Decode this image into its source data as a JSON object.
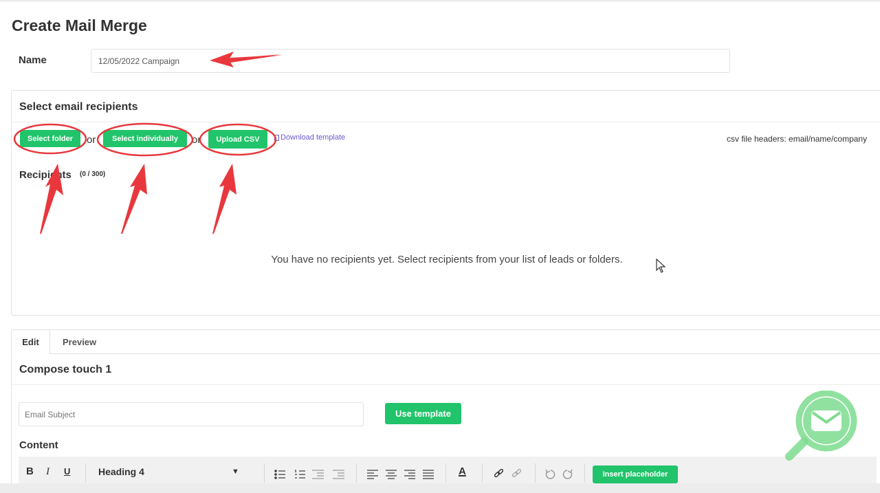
{
  "page": {
    "title": "Create Mail Merge"
  },
  "name_field": {
    "label": "Name",
    "value": "12/05/2022 Campaign"
  },
  "recipients_panel": {
    "title": "Select email recipients",
    "select_folder": "Select folder",
    "or1": "or",
    "select_individually": "Select individually",
    "or2": "or",
    "upload_csv": "Upload CSV",
    "download_template": "Download template",
    "csv_headers": "csv file headers: email/name/company",
    "recipients_label": "Recipients",
    "recipients_count": "(0 / 300)",
    "empty_message": "You have no recipients yet. Select recipients from your list of leads or folders."
  },
  "tabs": {
    "edit": "Edit",
    "preview": "Preview"
  },
  "compose": {
    "title": "Compose touch 1",
    "subject_placeholder": "Email Subject",
    "use_template": "Use template",
    "content_label": "Content"
  },
  "toolbar": {
    "bold": "B",
    "italic": "I",
    "underline": "U",
    "heading_select": "Heading 4",
    "font_color": "A",
    "insert_placeholder": "Insert placeholder"
  },
  "colors": {
    "accent_green": "#21c46a",
    "annotation_red": "#e8383d",
    "link_purple": "#6a5acd",
    "logo_green": "#7ddc8f"
  }
}
